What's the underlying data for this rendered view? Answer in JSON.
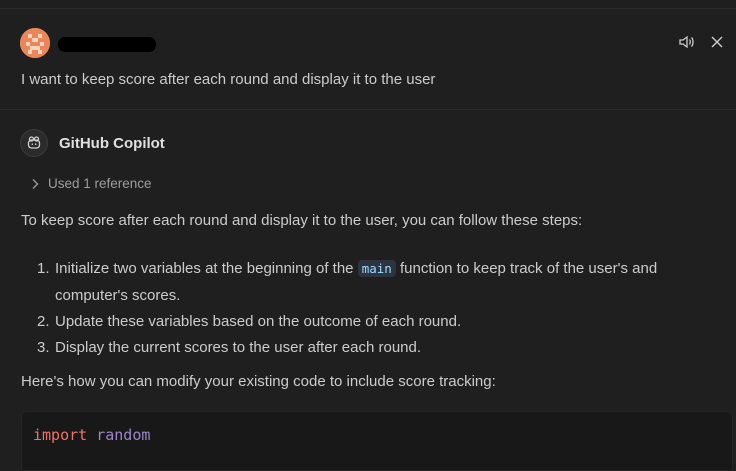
{
  "user": {
    "message": "I want to keep score after each round and display it to the user",
    "actions": [
      "speaker-icon",
      "close-icon"
    ]
  },
  "response": {
    "author": "GitHub Copilot",
    "reference_label": "Used 1 reference",
    "intro": "To keep score after each round and display it to the user, you can follow these steps:",
    "steps": [
      {
        "num": "1.",
        "before": "Initialize two variables at the beginning of the ",
        "code": "main",
        "after_line1": " function to keep track of the user's and",
        "after_line2": "computer's scores."
      },
      {
        "num": "2.",
        "text": "Update these variables based on the outcome of each round."
      },
      {
        "num": "3.",
        "text": "Display the current scores to the user after each round."
      }
    ],
    "outro": "Here's how you can modify your existing code to include score tracking:",
    "code": {
      "keyword": "import",
      "module": "random"
    }
  },
  "colors": {
    "background": "#1f1f1f",
    "text": "#cccccc",
    "keyword": "#f47067",
    "module": "#9e86c8",
    "inline_code": "#9cdcfe"
  }
}
